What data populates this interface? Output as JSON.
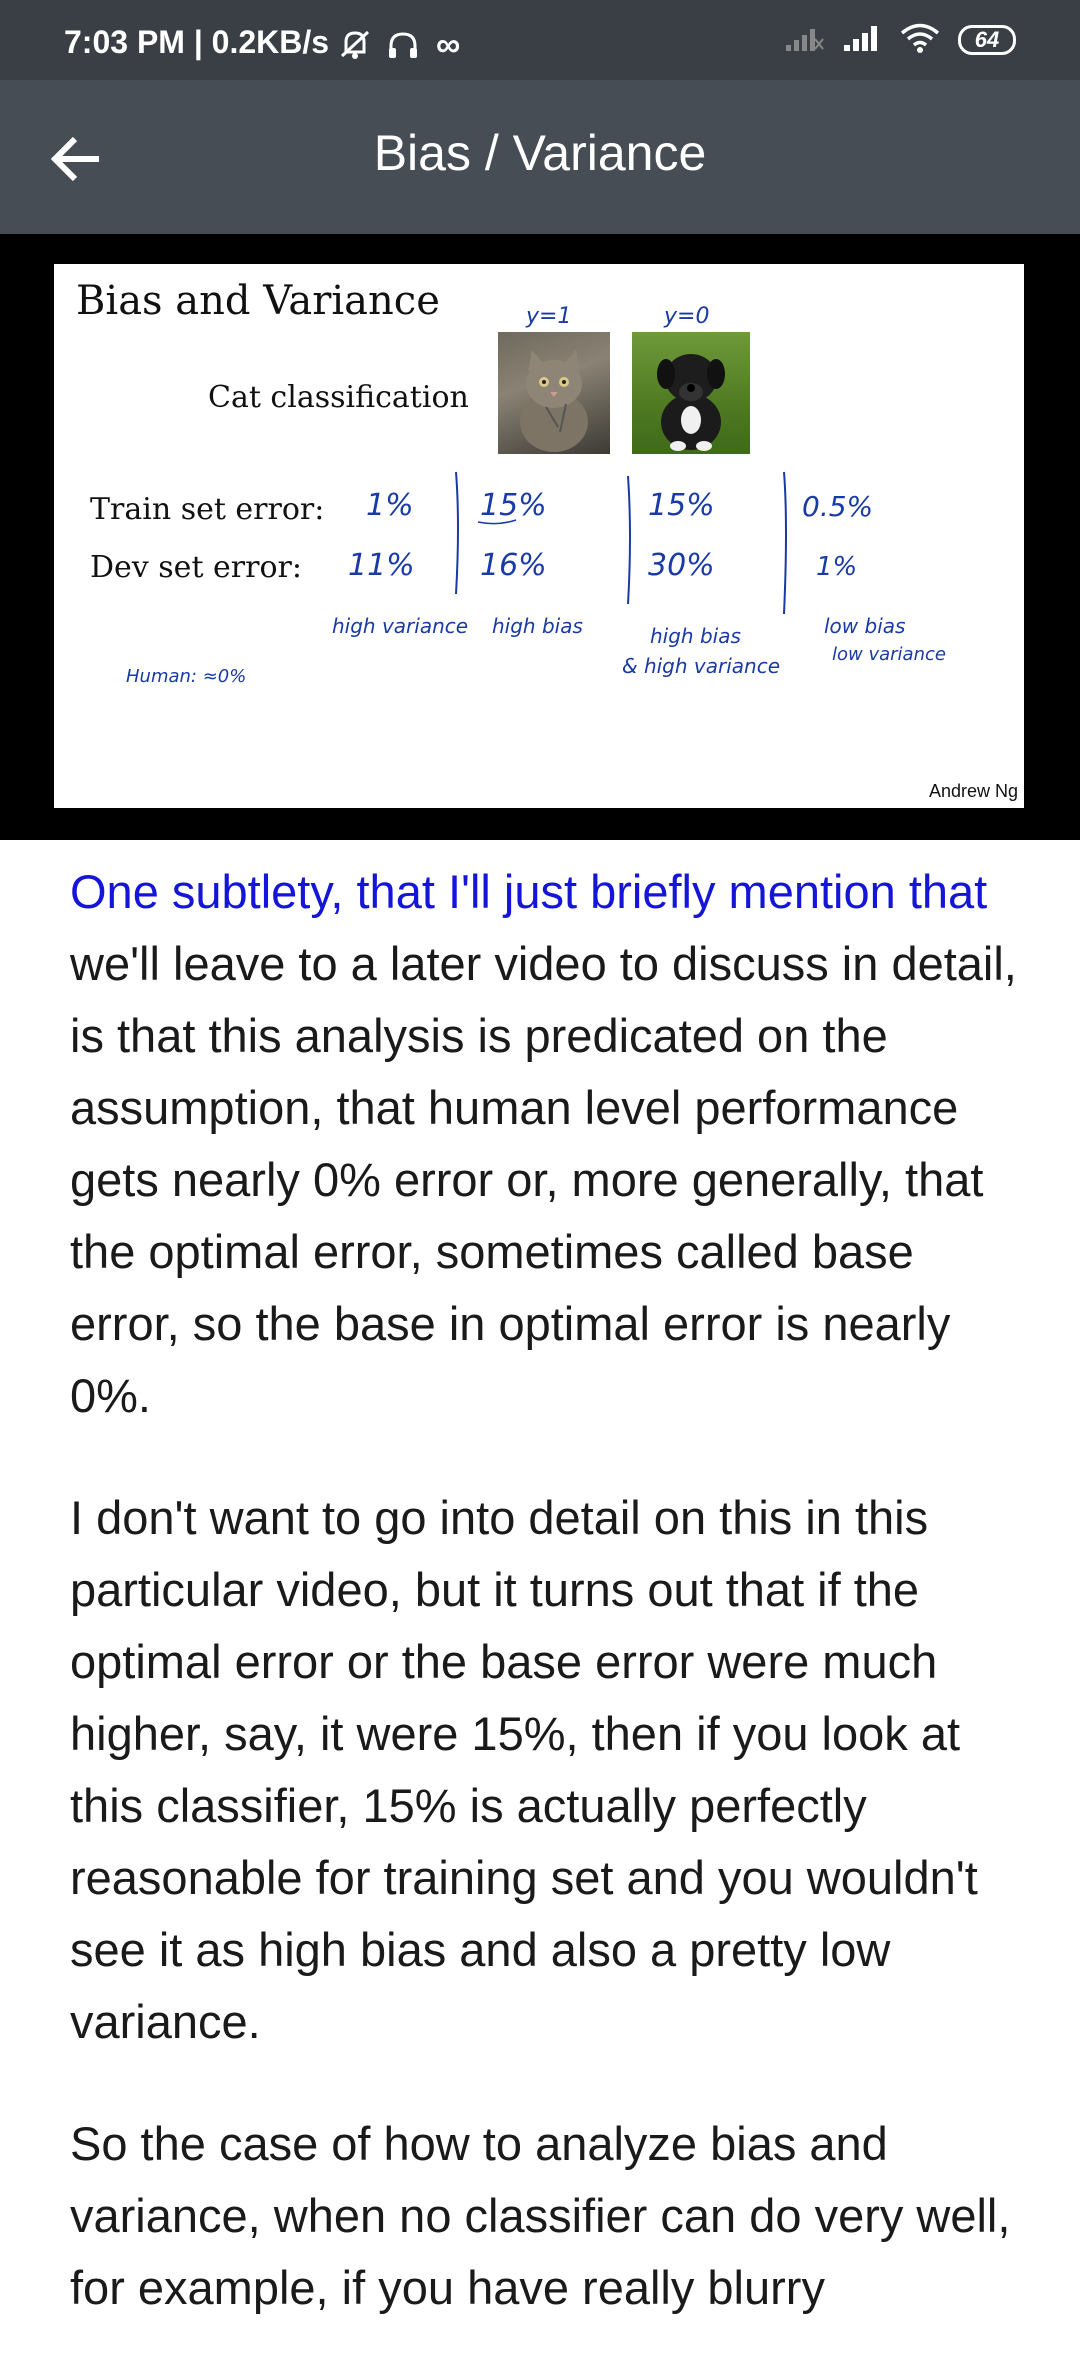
{
  "status_bar": {
    "time": "7:03 PM | 0.2KB/s",
    "battery": "64",
    "icons": [
      "mute-icon",
      "headset-icon",
      "infinity-icon",
      "signal-icon",
      "signal-icon",
      "wifi-icon",
      "battery-icon"
    ]
  },
  "app_bar": {
    "title": "Bias / Variance",
    "back_icon": "back-arrow-icon"
  },
  "slide": {
    "title": "Bias and Variance",
    "subtitle": "Cat classification",
    "label_y1": "y=1",
    "label_y0": "y=0",
    "train_label": "Train set error:",
    "dev_label": "Dev set error:",
    "columns": [
      {
        "train": "1%",
        "dev": "11%",
        "note1": "high variance",
        "note2": ""
      },
      {
        "train": "15%",
        "dev": "16%",
        "note1": "high bias",
        "note2": ""
      },
      {
        "train": "15%",
        "dev": "30%",
        "note1": "high bias",
        "note2": "& high variance"
      },
      {
        "train": "0.5%",
        "dev": "1%",
        "note1": "low bias",
        "note2": "low variance"
      }
    ],
    "human_note": "Human: ≈0%",
    "credit": "Andrew Ng"
  },
  "captions": {
    "p1_highlight": "One subtlety, that I'll just briefly mention that",
    "p1_rest": " we'll leave to a later video to discuss in detail, is that this analysis is predicated on the assumption, that human level performance gets nearly 0% error or, more generally, that the optimal error, sometimes called base error, so the base in optimal error is nearly 0%.",
    "p2": "I don't want to go into detail on this in this particular video, but it turns out that if the optimal error or the base error were much higher, say, it were 15%, then if you look at this classifier, 15% is actually perfectly reasonable for training set and you wouldn't see it as high bias and also a pretty low variance.",
    "p3": "So the case of how to analyze bias and variance, when no classifier can do very well, for example, if you have really blurry"
  }
}
